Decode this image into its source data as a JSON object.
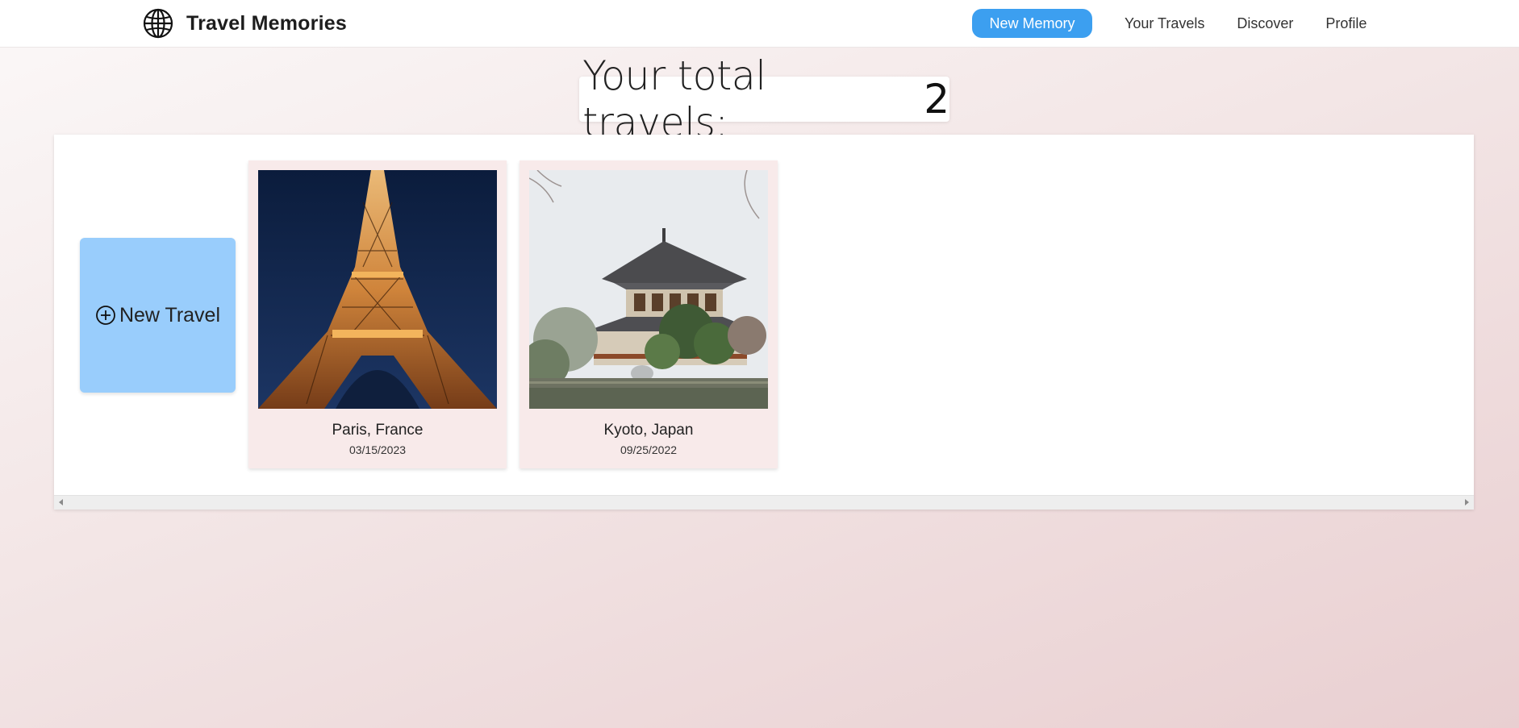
{
  "header": {
    "logo_icon": "globe-icon",
    "title": "Travel Memories",
    "new_memory_label": "New Memory",
    "nav_links": [
      "Your Travels",
      "Discover",
      "Profile"
    ],
    "accent_color": "#3c9ff0"
  },
  "summary": {
    "label": "Your total travels:",
    "count": "2"
  },
  "new_travel": {
    "icon": "plus-circle-icon",
    "label": "New Travel",
    "color": "#99cdfc"
  },
  "travels": [
    {
      "city": "Paris, France",
      "date": "03/15/2023",
      "image": "eiffel-tower-photo"
    },
    {
      "city": "Kyoto, Japan",
      "date": "09/25/2022",
      "image": "japanese-temple-photo"
    }
  ]
}
